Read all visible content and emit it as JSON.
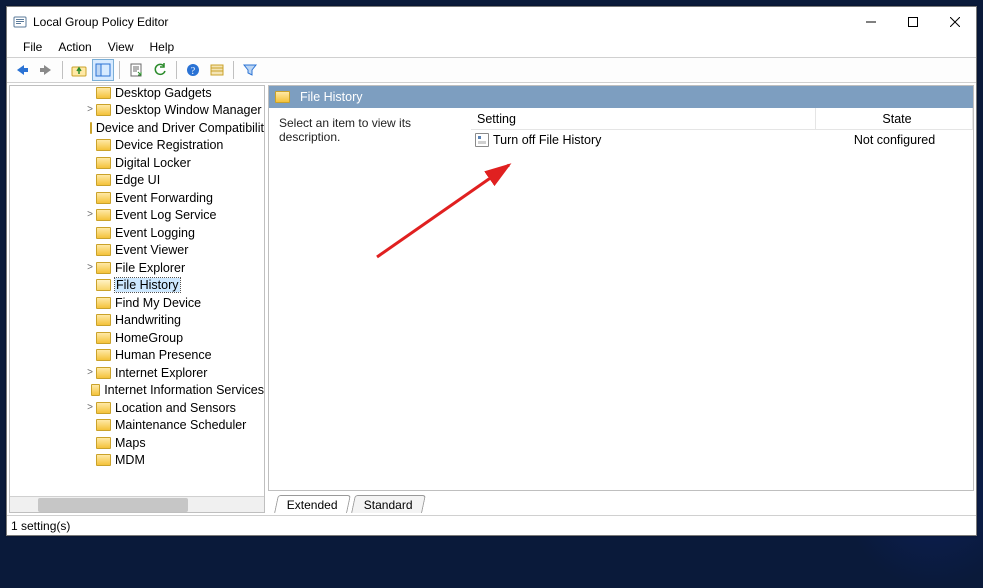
{
  "window": {
    "title": "Local Group Policy Editor"
  },
  "menu": {
    "items": [
      "File",
      "Action",
      "View",
      "Help"
    ]
  },
  "toolbar": {
    "back": "nav-back",
    "forward": "nav-forward",
    "up": "folder-up",
    "props": "show-properties",
    "refresh": "refresh",
    "export": "export-list",
    "help": "help",
    "std_toolbar": "standard-toolbar",
    "filter": "filter"
  },
  "tree": {
    "items": [
      {
        "label": "Desktop Gadgets",
        "expandable": false
      },
      {
        "label": "Desktop Window Manager",
        "expandable": true
      },
      {
        "label": "Device and Driver Compatibility",
        "expandable": false
      },
      {
        "label": "Device Registration",
        "expandable": false
      },
      {
        "label": "Digital Locker",
        "expandable": false
      },
      {
        "label": "Edge UI",
        "expandable": false
      },
      {
        "label": "Event Forwarding",
        "expandable": false
      },
      {
        "label": "Event Log Service",
        "expandable": true
      },
      {
        "label": "Event Logging",
        "expandable": false
      },
      {
        "label": "Event Viewer",
        "expandable": false
      },
      {
        "label": "File Explorer",
        "expandable": true
      },
      {
        "label": "File History",
        "expandable": false,
        "selected": true
      },
      {
        "label": "Find My Device",
        "expandable": false
      },
      {
        "label": "Handwriting",
        "expandable": false
      },
      {
        "label": "HomeGroup",
        "expandable": false
      },
      {
        "label": "Human Presence",
        "expandable": false
      },
      {
        "label": "Internet Explorer",
        "expandable": true
      },
      {
        "label": "Internet Information Services",
        "expandable": false
      },
      {
        "label": "Location and Sensors",
        "expandable": true
      },
      {
        "label": "Maintenance Scheduler",
        "expandable": false
      },
      {
        "label": "Maps",
        "expandable": false
      },
      {
        "label": "MDM",
        "expandable": false
      }
    ]
  },
  "panel": {
    "title": "File History",
    "description_prompt": "Select an item to view its description.",
    "columns": {
      "setting": "Setting",
      "state": "State"
    },
    "rows": [
      {
        "setting": "Turn off File History",
        "state": "Not configured"
      }
    ]
  },
  "tabs": {
    "extended": "Extended",
    "standard": "Standard",
    "active": "extended"
  },
  "status": {
    "text": "1 setting(s)"
  }
}
